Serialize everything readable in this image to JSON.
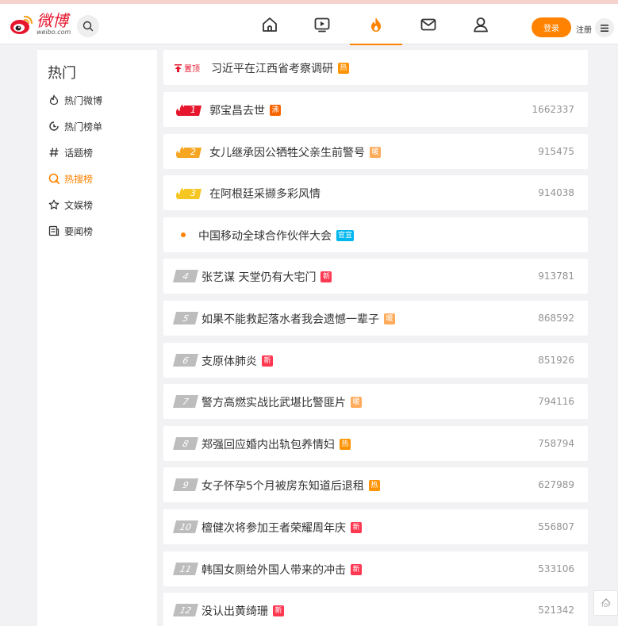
{
  "header": {
    "logo_cn": "微博",
    "logo_en": "weibo.com",
    "login_label": "登录",
    "register_label": "注册",
    "nav": [
      {
        "icon": "home-icon"
      },
      {
        "icon": "video-icon"
      },
      {
        "icon": "fire-icon",
        "active": true
      },
      {
        "icon": "mail-icon"
      },
      {
        "icon": "user-icon"
      }
    ],
    "accent": "#ff8200"
  },
  "sidebar": {
    "title": "热门",
    "items": [
      {
        "label": "热门微博",
        "icon": "hot-weibo-icon"
      },
      {
        "label": "热门榜单",
        "icon": "clock-icon"
      },
      {
        "label": "话题榜",
        "icon": "hashtag-icon"
      },
      {
        "label": "热搜榜",
        "icon": "search-rank-icon",
        "active": true
      },
      {
        "label": "文娱榜",
        "icon": "star-icon"
      },
      {
        "label": "要闻榜",
        "icon": "news-icon"
      }
    ]
  },
  "hot_list": {
    "pinned": {
      "pin_label": "置顶",
      "title": "习近平在江西省考察调研",
      "badge": "热",
      "badge_color": "#ff9406"
    },
    "items": [
      {
        "rank": "1",
        "title": "郭宝昌去世",
        "badge": "沸",
        "badge_color": "#f86400",
        "count": "1662337",
        "style": "top1"
      },
      {
        "rank": "2",
        "title": "女儿继承因公牺牲父亲生前警号",
        "badge": "暖",
        "badge_color": "#ffab5a",
        "count": "915475",
        "style": "top2"
      },
      {
        "rank": "3",
        "title": "在阿根廷采撷多彩风情",
        "badge": "",
        "count": "914038",
        "style": "top3"
      },
      {
        "rank": "",
        "title": "中国移动全球合作伙伴大会",
        "badge": "官宣",
        "badge_color": "#00b7ee",
        "count": "",
        "style": "promo"
      },
      {
        "rank": "4",
        "title": "张艺谋 天堂仍有大宅门",
        "badge": "新",
        "badge_color": "#ff3852",
        "count": "913781",
        "style": "gray"
      },
      {
        "rank": "5",
        "title": "如果不能救起落水者我会遗憾一辈子",
        "badge": "暖",
        "badge_color": "#ffab5a",
        "count": "868592",
        "style": "gray"
      },
      {
        "rank": "6",
        "title": "支原体肺炎",
        "badge": "新",
        "badge_color": "#ff3852",
        "count": "851926",
        "style": "gray"
      },
      {
        "rank": "7",
        "title": "警方高燃实战比武堪比警匪片",
        "badge": "暖",
        "badge_color": "#ffab5a",
        "count": "794116",
        "style": "gray"
      },
      {
        "rank": "8",
        "title": "郑强回应婚内出轨包养情妇",
        "badge": "热",
        "badge_color": "#ff9406",
        "count": "758794",
        "style": "gray"
      },
      {
        "rank": "9",
        "title": "女子怀孕5个月被房东知道后退租",
        "badge": "热",
        "badge_color": "#ff9406",
        "count": "627989",
        "style": "gray"
      },
      {
        "rank": "10",
        "title": "檀健次将参加王者荣耀周年庆",
        "badge": "新",
        "badge_color": "#ff3852",
        "count": "556807",
        "style": "gray"
      },
      {
        "rank": "11",
        "title": "韩国女厕给外国人带来的冲击",
        "badge": "新",
        "badge_color": "#ff3852",
        "count": "533106",
        "style": "gray"
      },
      {
        "rank": "12",
        "title": "没认出黄绮珊",
        "badge": "新",
        "badge_color": "#ff3852",
        "count": "521342",
        "style": "gray"
      }
    ]
  },
  "back_to_top": {
    "label": "TOP"
  }
}
